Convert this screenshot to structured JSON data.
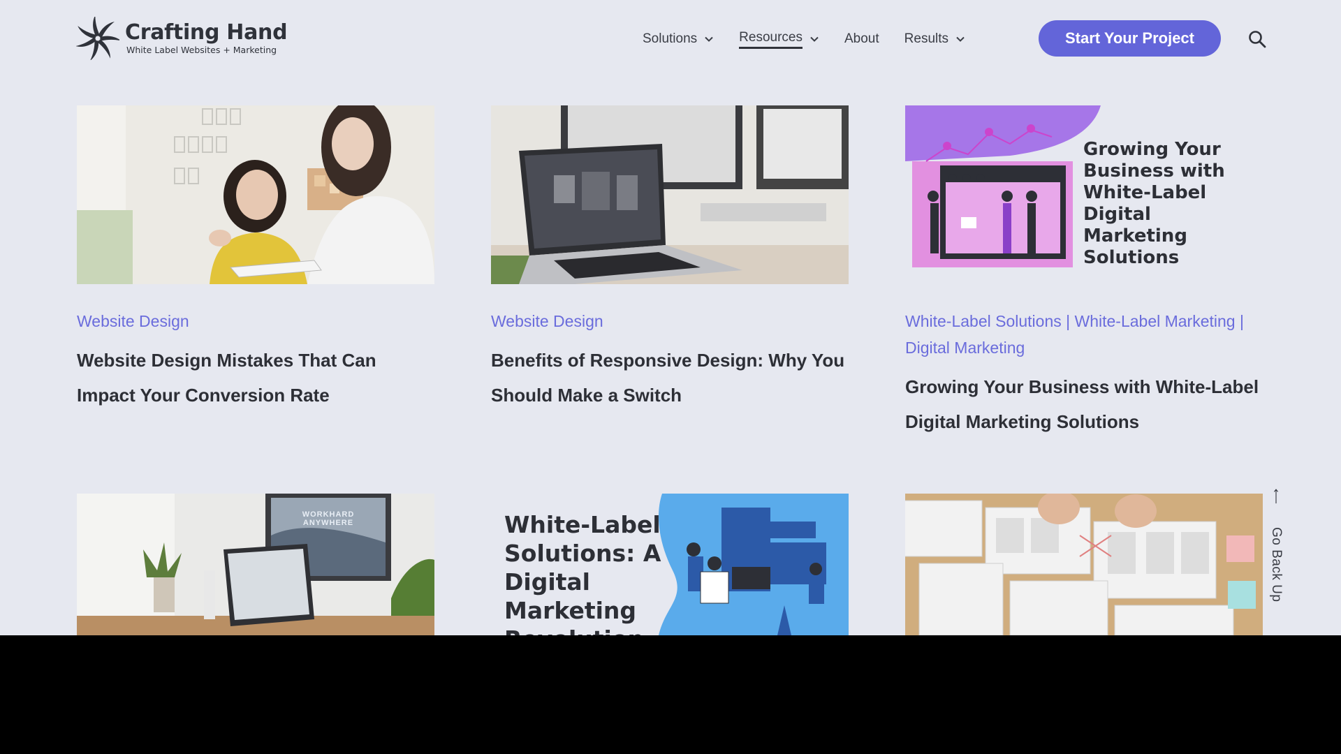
{
  "brand": {
    "name": "Crafting Hand",
    "tagline": "White Label Websites + Marketing",
    "logo_icon": "pinwheel-logo-icon"
  },
  "nav": {
    "items": [
      {
        "label": "Solutions",
        "has_dropdown": true,
        "active": false
      },
      {
        "label": "Resources",
        "has_dropdown": true,
        "active": true
      },
      {
        "label": "About",
        "has_dropdown": false,
        "active": false
      },
      {
        "label": "Results",
        "has_dropdown": true,
        "active": false
      }
    ],
    "cta_label": "Start Your Project",
    "search_icon": "search-icon"
  },
  "posts": [
    {
      "category": "Website Design",
      "title": "Website Design Mistakes That Can Impact Your Conversion Rate",
      "image": "two-women-discussing-tablet-photo"
    },
    {
      "category": "Website Design",
      "title": "Benefits of Responsive Design: Why You Should Make a Switch",
      "image": "laptop-and-monitors-photo"
    },
    {
      "category": "White-Label Solutions | White-Label Marketing | Digital Marketing",
      "title": "Growing Your Business with White-Label Digital Marketing Solutions",
      "image": "growing-business-illustration",
      "image_text": "Growing Your Business with White-Label Digital Marketing Solutions"
    },
    {
      "image": "laptop-workspace-photo",
      "image_text": "WORKHARD ANYWHERE"
    },
    {
      "image": "white-label-revolution-illustration",
      "image_text": "White-Label Solutions: A Digital Marketing Revolution"
    },
    {
      "image": "wireframe-sketching-photo"
    }
  ],
  "go_back_up": "Go Back Up",
  "colors": {
    "accent": "#6365d9",
    "background": "#e6e8f0",
    "text": "#2d2f36"
  }
}
